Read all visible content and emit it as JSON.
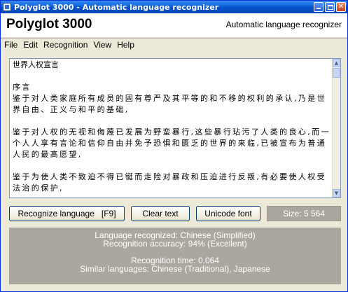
{
  "window": {
    "title": "Polyglot 3000 - Automatic language recognizer"
  },
  "header": {
    "app_name": "Polyglot 3000",
    "subtitle": "Automatic language recognizer"
  },
  "menu": [
    "File",
    "Edit",
    "Recognition",
    "View",
    "Help"
  ],
  "text_area": {
    "paragraphs": [
      "世界人权宣言",
      "序言\n鉴于对人类家庭所有成员的固有尊严及其平等的和不移的权利的承认,乃是世界自由、正义与和平的基础,",
      "鉴于对人权的无视和侮蔑已发展为野蛮暴行,这些暴行玷污了人类的良心,而一个人人享有言论和信仰自由并免予恐惧和匮乏的世界的来临,已被宣布为普通人民的最高愿望,",
      "鉴于为使人类不致迫不得已铤而走险对暴政和压迫进行反叛,有必要使人权受法治的保护,"
    ]
  },
  "buttons": {
    "recognize": "Recognize language   [F9]",
    "clear": "Clear text",
    "unicode": "Unicode font"
  },
  "size_label": "Size: 5 564",
  "results": {
    "language": "Language recognized: Chinese (Simplified)",
    "accuracy": "Recognition accuracy: 94% (Excellent)",
    "time": "Recognition time: 0.064",
    "similar": "Similar languages: Chinese (Traditional), Japanese"
  },
  "icons": {
    "minimize": "minimize-icon",
    "maximize": "maximize-icon",
    "close": "close-icon",
    "scroll_up": "scroll-up-arrow-icon",
    "scroll_down": "scroll-down-arrow-icon"
  },
  "colors": {
    "titlebar": "#0a5fd8",
    "results_bg": "#aaa89e",
    "text_border": "#7f9db9"
  }
}
